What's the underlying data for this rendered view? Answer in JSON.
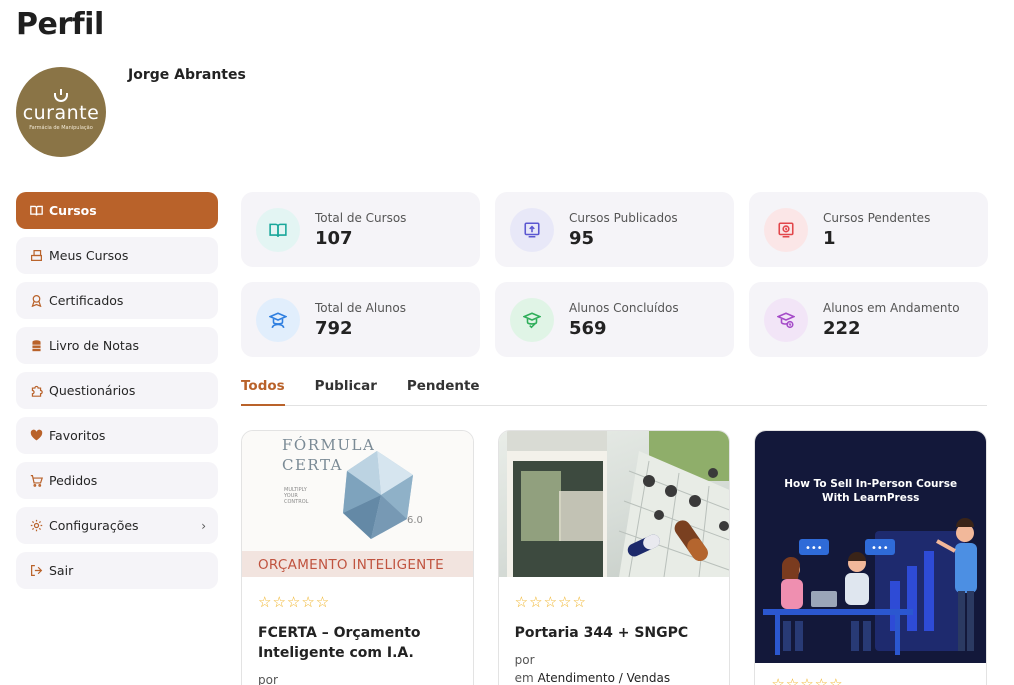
{
  "page": {
    "title": "Perfil"
  },
  "profile": {
    "name": "Jorge Abrantes",
    "avatar_text": "curante",
    "avatar_subtext": "Farmácia de Manipulação"
  },
  "sidebar": {
    "items": [
      {
        "label": "Cursos",
        "icon": "book-open-icon",
        "active": true
      },
      {
        "label": "Meus Cursos",
        "icon": "courses-icon"
      },
      {
        "label": "Certificados",
        "icon": "certificate-icon"
      },
      {
        "label": "Livro de Notas",
        "icon": "gradebook-icon"
      },
      {
        "label": "Questionários",
        "icon": "puzzle-icon"
      },
      {
        "label": "Favoritos",
        "icon": "heart-icon"
      },
      {
        "label": "Pedidos",
        "icon": "cart-icon"
      },
      {
        "label": "Configurações",
        "icon": "gear-icon",
        "has_submenu": true
      },
      {
        "label": "Sair",
        "icon": "logout-icon"
      }
    ]
  },
  "stats": [
    {
      "label": "Total de Cursos",
      "value": "107",
      "icon": "book-icon",
      "bg": "#e3f5f3",
      "color": "#19a79a"
    },
    {
      "label": "Cursos Publicados",
      "value": "95",
      "icon": "publish-icon",
      "bg": "#e8e8f8",
      "color": "#5b57d1"
    },
    {
      "label": "Cursos Pendentes",
      "value": "1",
      "icon": "pending-icon",
      "bg": "#fbe6e7",
      "color": "#e2464b"
    },
    {
      "label": "Total de Alunos",
      "value": "792",
      "icon": "students-icon",
      "bg": "#e1eefc",
      "color": "#2f7fe0"
    },
    {
      "label": "Alunos Concluídos",
      "value": "569",
      "icon": "graduated-icon",
      "bg": "#e0f4e6",
      "color": "#2fae5a"
    },
    {
      "label": "Alunos em Andamento",
      "value": "222",
      "icon": "in-progress-icon",
      "bg": "#f2e5f7",
      "color": "#a54bc8"
    }
  ],
  "tabs": [
    {
      "label": "Todos",
      "active": true
    },
    {
      "label": "Publicar"
    },
    {
      "label": "Pendente"
    }
  ],
  "courses": [
    {
      "title": "FCERTA – Orçamento Inteligente com I.A.",
      "by": "por",
      "category_prefix": "",
      "category": "",
      "rating": 0,
      "thumb_brand_line1": "FÓRMULA",
      "thumb_brand_line2": "CERTA",
      "thumb_small": "MULTIPLY YOUR CONTROL",
      "thumb_version": "6.0",
      "thumb_band": "ORÇAMENTO INTELIGENTE"
    },
    {
      "title": "Portaria 344 + SNGPC",
      "by": "por",
      "category_prefix": "em",
      "category": "Atendimento / Vendas",
      "rating": 0
    },
    {
      "title": "",
      "by": "",
      "category_prefix": "",
      "category": "",
      "rating": 0,
      "thumb_heading_line1": "How To Sell In-Person Course",
      "thumb_heading_line2": "With LearnPress"
    }
  ],
  "stars_empty": "☆☆☆☆☆",
  "colors": {
    "accent": "#b9622a",
    "panel": "#f5f4f8",
    "star": "#f0b429"
  }
}
